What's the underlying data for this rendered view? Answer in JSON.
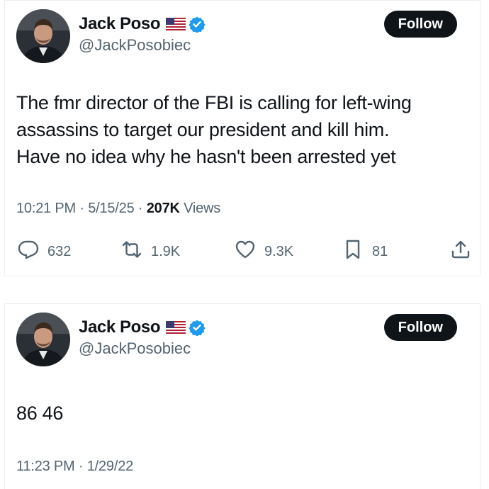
{
  "tweets": [
    {
      "display_name": "Jack Poso",
      "handle": "@JackPosobiec",
      "follow_label": "Follow",
      "text": "The fmr director of the FBI is calling for left-wing\nassassins to target our president and kill him.\nHave no idea why he hasn't been arrested yet",
      "time": "10:21 PM",
      "date": "5/15/25",
      "views_count": "207K",
      "views_label": "Views",
      "replies": "632",
      "reposts": "1.9K",
      "likes": "9.3K",
      "bookmarks": "81"
    },
    {
      "display_name": "Jack Poso",
      "handle": "@JackPosobiec",
      "follow_label": "Follow",
      "text": "86 46",
      "time": "11:23 PM",
      "date": "1/29/22"
    }
  ],
  "separator": "·",
  "icons": {
    "flag": "us-flag-icon",
    "verified": "verified-badge-icon",
    "reply": "reply-icon",
    "repost": "repost-icon",
    "like": "heart-icon",
    "bookmark": "bookmark-icon",
    "share": "share-icon"
  },
  "colors": {
    "text": "#0f1419",
    "secondary": "#536471",
    "verified": "#1d9bf0",
    "follow_bg": "#0f1419"
  }
}
